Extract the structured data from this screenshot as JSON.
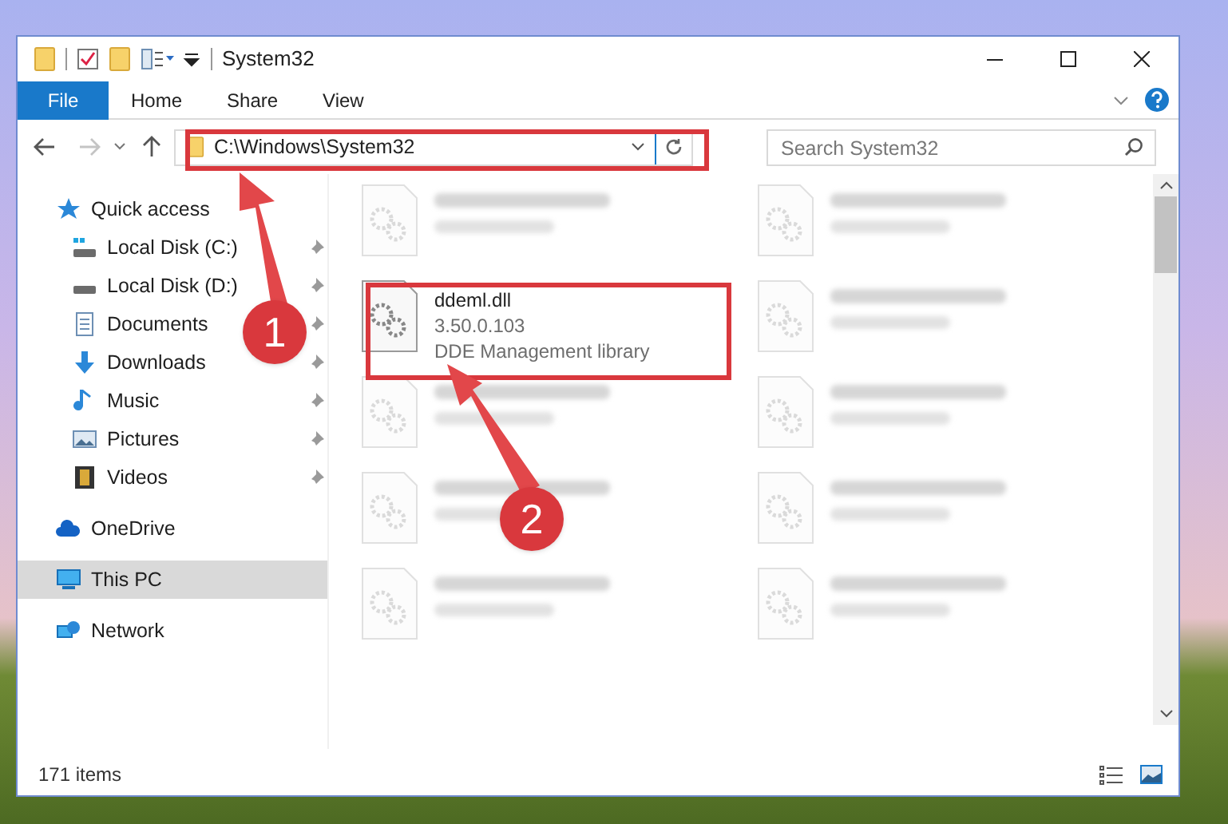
{
  "window": {
    "title": "System32"
  },
  "ribbon": {
    "tabs": [
      {
        "label": "File",
        "kind": "file"
      },
      {
        "label": "Home",
        "kind": "tab"
      },
      {
        "label": "Share",
        "kind": "tab"
      },
      {
        "label": "View",
        "kind": "tab"
      }
    ]
  },
  "address": {
    "path": "C:\\Windows\\System32"
  },
  "search": {
    "placeholder": "Search System32"
  },
  "sidebar": {
    "items": [
      {
        "label": "Quick access",
        "kind": "star",
        "selected": false,
        "children": [
          {
            "label": "Local Disk (C:)",
            "kind": "system-drive",
            "pinned": true,
            "selected": false
          },
          {
            "label": "Local Disk (D:)",
            "kind": "drive",
            "pinned": true,
            "selected": false
          },
          {
            "label": "Documents",
            "kind": "document",
            "pinned": true,
            "selected": false
          },
          {
            "label": "Downloads",
            "kind": "download",
            "pinned": true,
            "selected": false
          },
          {
            "label": "Music",
            "kind": "music",
            "pinned": true,
            "selected": false
          },
          {
            "label": "Pictures",
            "kind": "picture",
            "pinned": true,
            "selected": false
          },
          {
            "label": "Videos",
            "kind": "video",
            "pinned": true,
            "selected": false
          }
        ]
      },
      {
        "label": "OneDrive",
        "kind": "cloud",
        "selected": false
      },
      {
        "label": "This PC",
        "kind": "computer",
        "selected": true
      },
      {
        "label": "Network",
        "kind": "network",
        "selected": false
      }
    ]
  },
  "files": [
    {
      "blurred": true
    },
    {
      "blurred": true
    },
    {
      "name": "ddeml.dll",
      "details": [
        "3.50.0.103",
        "DDE Management library"
      ],
      "blurred": false
    },
    {
      "blurred": true
    },
    {
      "blurred": true
    },
    {
      "blurred": true
    },
    {
      "blurred": true
    },
    {
      "blurred": true
    },
    {
      "blurred": true
    },
    {
      "blurred": true
    }
  ],
  "status_bar": {
    "item_count": "171 items"
  },
  "annotations": [
    {
      "number": "1"
    },
    {
      "number": "2"
    }
  ]
}
